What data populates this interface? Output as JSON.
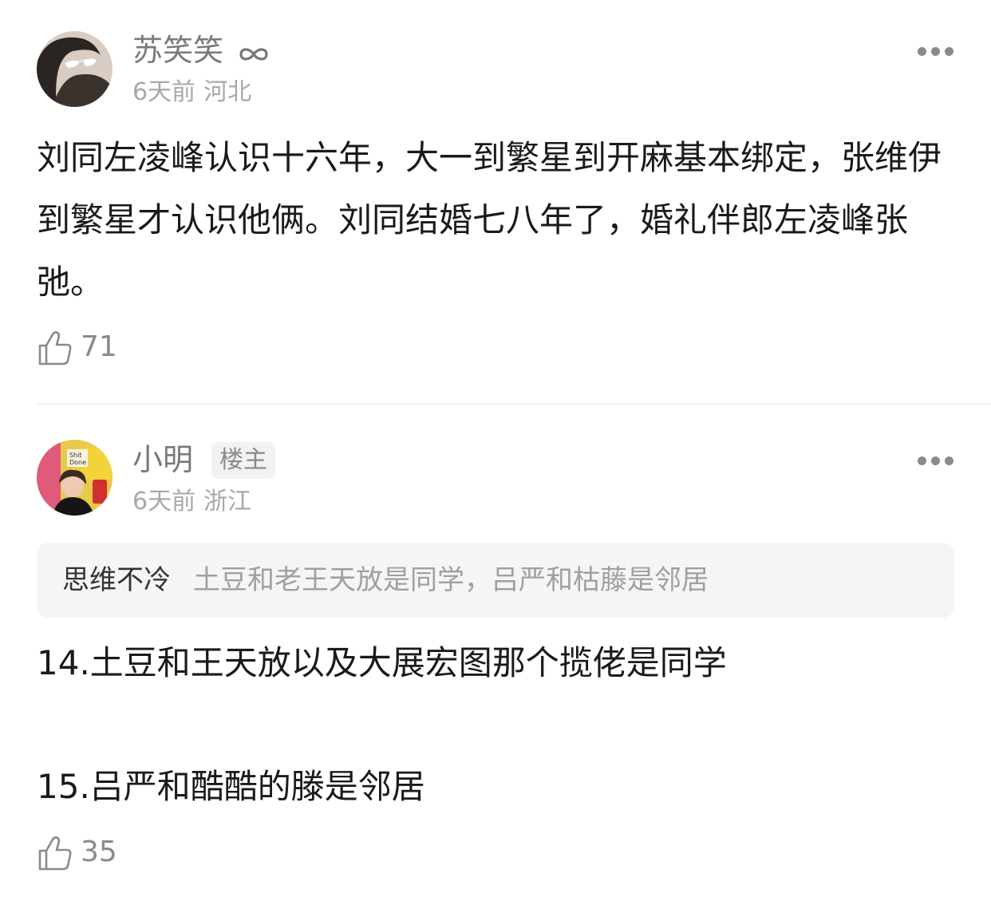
{
  "comments": [
    {
      "user": "苏笑笑",
      "time": "6天前",
      "location": "河北",
      "text": "刘同左凌峰认识十六年，大一到繁星到开麻基本绑定，张维伊到繁星才认识他俩。刘同结婚七八年了，婚礼伴郎左凌峰张弛。",
      "likes": "71"
    },
    {
      "user": "小明",
      "badge": "楼主",
      "time": "6天前",
      "location": "浙江",
      "quote": {
        "user": "思维不冷",
        "text": "土豆和老王天放是同学，吕严和枯藤是邻居"
      },
      "reply_lines": [
        "14.土豆和王天放以及大展宏图那个揽佬是同学",
        "15.吕严和酷酷的滕是邻居"
      ],
      "likes": "35"
    }
  ],
  "icons": {
    "more": "more-dots-icon",
    "like": "thumbs-up-icon",
    "badge": "infinity-icon"
  }
}
